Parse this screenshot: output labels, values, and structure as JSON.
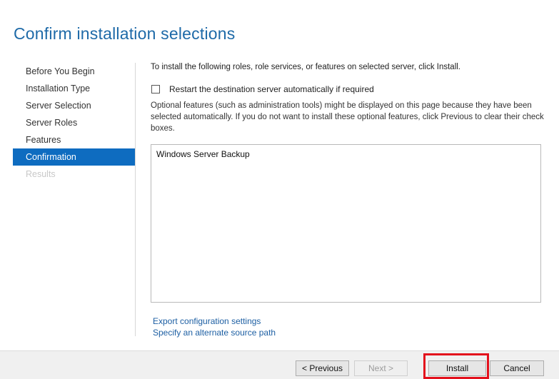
{
  "page": {
    "title": "Confirm installation selections"
  },
  "nav": {
    "items": [
      {
        "label": "Before You Begin",
        "state": "normal"
      },
      {
        "label": "Installation Type",
        "state": "normal"
      },
      {
        "label": "Server Selection",
        "state": "normal"
      },
      {
        "label": "Server Roles",
        "state": "normal"
      },
      {
        "label": "Features",
        "state": "normal"
      },
      {
        "label": "Confirmation",
        "state": "active"
      },
      {
        "label": "Results",
        "state": "disabled"
      }
    ]
  },
  "content": {
    "intro": "To install the following roles, role services, or features on selected server, click Install.",
    "restart_checkbox": {
      "label": "Restart the destination server automatically if required",
      "checked": false
    },
    "optional_note": "Optional features (such as administration tools) might be displayed on this page because they have been selected automatically. If you do not want to install these optional features, click Previous to clear their check boxes.",
    "features": [
      "Windows Server Backup"
    ],
    "links": {
      "export": "Export configuration settings",
      "alternate_source": "Specify an alternate source path"
    }
  },
  "footer": {
    "previous_label": "< Previous",
    "next_label": "Next >",
    "install_label": "Install",
    "cancel_label": "Cancel"
  },
  "colors": {
    "title": "#1e6aa8",
    "nav_active_bg": "#0e6cc0",
    "link": "#1d5fa3",
    "highlight": "#e3101c"
  }
}
